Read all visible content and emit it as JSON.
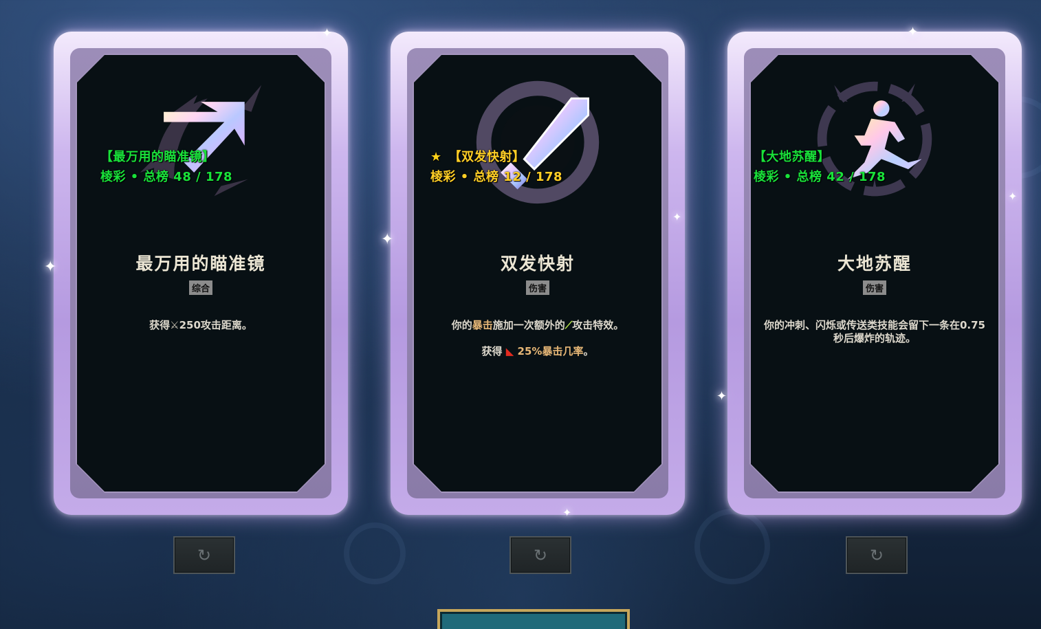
{
  "cards": [
    {
      "rank_name": "【最万用的瞄准镜】",
      "rank_line": "棱彩 • 总榜 48 / 178",
      "starred": false,
      "title": "最万用的瞄准镜",
      "tag": "综合",
      "desc": [
        [
          {
            "t": "获得"
          },
          {
            "icon": "sword-icon",
            "t": "⚔"
          },
          {
            "t": "250攻击距离。"
          }
        ]
      ],
      "emblem": "arrow-icon"
    },
    {
      "rank_name": "【双发快射】",
      "rank_line": "棱彩 • 总榜 12 / 178",
      "starred": true,
      "title": "双发快射",
      "tag": "伤害",
      "desc": [
        [
          {
            "t": "你的"
          },
          {
            "t": "暴击",
            "hl": true
          },
          {
            "t": "施加一次额外的"
          },
          {
            "icon": "onhit-icon",
            "t": "⟋"
          },
          {
            "t": "攻击特效。"
          }
        ],
        [
          {
            "t": "获得 "
          },
          {
            "icon": "crit-icon",
            "t": "◣"
          },
          {
            "t": " 25%暴击几率",
            "hl": true
          },
          {
            "t": "。"
          }
        ]
      ],
      "emblem": "sword-icon"
    },
    {
      "rank_name": "【大地苏醒】",
      "rank_line": "棱彩 • 总榜 42 / 178",
      "starred": false,
      "title": "大地苏醒",
      "tag": "伤害",
      "desc": [
        [
          {
            "t": "你的冲刺、闪烁或传送类技能会留下一条在0.75秒后爆炸的轨迹。"
          }
        ]
      ],
      "emblem": "runner-icon"
    }
  ],
  "reroll_icon": "↻",
  "star_glyph": "★",
  "colors": {
    "rank_green": "#19e23a",
    "rank_gold": "#ffcf26",
    "highlight": "#e8b877"
  }
}
